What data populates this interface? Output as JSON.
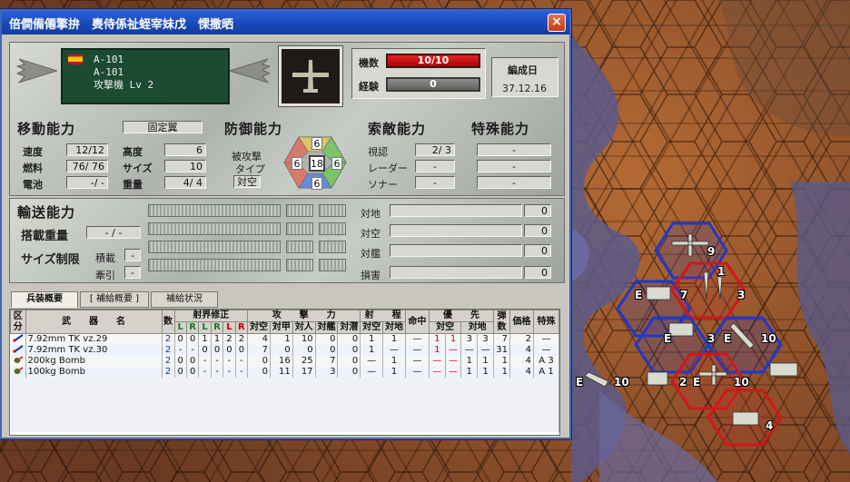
{
  "window": {
    "title": "倍僴備僊擎拚　軣侍係祉蛭宰妹戊　惈撒晒",
    "close_label": "×"
  },
  "unit": {
    "name_line1": "A-101",
    "name_line2": "A-101",
    "type_line": "攻撃機 Lv 2",
    "count_label": "機数",
    "count_value": "10/10",
    "exp_label": "経験",
    "exp_value": "0",
    "formed_label": "編成日",
    "formed_value": "37.12.16"
  },
  "movement": {
    "title": "移動能力",
    "type_value": "固定翼",
    "speed_label": "速度",
    "speed_value": "12/12",
    "fuel_label": "燃料",
    "fuel_value": "76/ 76",
    "battery_label": "電池",
    "battery_value": "-/ -",
    "altitude_label": "高度",
    "altitude_value": "6",
    "size_label": "サイズ",
    "size_value": "10",
    "weight_label": "重量",
    "weight_value": "4/ 4"
  },
  "defense": {
    "title": "防御能力",
    "attack_type_label1": "被攻撃",
    "attack_type_label2": "タイプ",
    "attack_type_value": "対空",
    "top": "6",
    "left": "6",
    "center": "18",
    "right": "6",
    "bottom": "6"
  },
  "search": {
    "title": "索敵能力",
    "visual_label": "視認",
    "visual_value": "2/ 3",
    "radar_label": "レーダー",
    "radar_value": "-",
    "sonar_label": "ソナー",
    "sonar_value": "-"
  },
  "special": {
    "title": "特殊能力",
    "slots": [
      "-",
      "-",
      "-",
      "-"
    ]
  },
  "transport": {
    "title": "輸送能力",
    "load_label": "搭載重量",
    "load_value": "- / -",
    "size_limit_label": "サイズ制限",
    "carry_label": "積載",
    "carry_value": "-",
    "tow_label": "牽引",
    "tow_value": "-"
  },
  "targets": [
    {
      "label": "対地",
      "value": "0"
    },
    {
      "label": "対空",
      "value": "0"
    },
    {
      "label": "対艦",
      "value": "0"
    },
    {
      "label": "損害",
      "value": "0"
    }
  ],
  "tabs": [
    "兵装概要",
    "[ 補給概要 ]",
    "補給状況"
  ],
  "weapons_table": {
    "h_kubun": "区分",
    "h_weapon": "武　　器　　名",
    "h_count": "数",
    "h_sight": "射界修正",
    "h_lr": [
      "L",
      "R",
      "L",
      "R",
      "L",
      "R"
    ],
    "h_attack": "攻　　撃　　力",
    "h_attack_sub": [
      "対空",
      "対甲",
      "対人",
      "対艦",
      "対潜"
    ],
    "h_range": "射　　程",
    "h_range_sub": [
      "対空",
      "対地"
    ],
    "h_hit": "命中",
    "h_priority": "優　　先",
    "h_priority_sub": [
      "対空",
      "対地"
    ],
    "h_ammo": "弾数",
    "h_price": "価格",
    "h_special": "特殊",
    "rows": [
      {
        "name": "7.92mm TK vz.29",
        "count": "2",
        "sight": [
          "0",
          "0",
          "1",
          "1",
          "2",
          "2"
        ],
        "atk": [
          "4",
          "1",
          "10",
          "0",
          "0"
        ],
        "rng_air": "1",
        "rng_gnd": "1",
        "hit": "—",
        "pri_air1": "1",
        "pri_air2": "1",
        "pri_gnd1": "3",
        "pri_gnd2": "3",
        "ammo": "7",
        "price": "2",
        "special": "—"
      },
      {
        "name": "7.92mm TK vz.30",
        "count": "2",
        "sight": [
          "-",
          "-",
          "0",
          "0",
          "0",
          "0"
        ],
        "atk": [
          "7",
          "0",
          "0",
          "0",
          "0"
        ],
        "rng_air": "1",
        "rng_gnd": "—",
        "hit": "—",
        "pri_air1": "1",
        "pri_air2": "—",
        "pri_gnd1": "—",
        "pri_gnd2": "—",
        "ammo": "31",
        "price": "4",
        "special": "—"
      },
      {
        "name": "200kg Bomb",
        "count": "2",
        "sight": [
          "0",
          "0",
          "-",
          "-",
          "-",
          "-"
        ],
        "atk": [
          "0",
          "16",
          "25",
          "7",
          "0"
        ],
        "rng_air": "—",
        "rng_gnd": "1",
        "hit": "—",
        "pri_air1": "—",
        "pri_air2": "—",
        "pri_gnd1": "1",
        "pri_gnd2": "1",
        "ammo": "1",
        "price": "4",
        "special": "A 3"
      },
      {
        "name": "100kg Bomb",
        "count": "2",
        "sight": [
          "0",
          "0",
          "-",
          "-",
          "-",
          "-"
        ],
        "atk": [
          "0",
          "11",
          "17",
          "3",
          "0"
        ],
        "rng_air": "—",
        "rng_gnd": "1",
        "hit": "—",
        "pri_air1": "—",
        "pri_air2": "—",
        "pri_gnd1": "1",
        "pri_gnd2": "1",
        "ammo": "1",
        "price": "4",
        "special": "A 1"
      }
    ]
  },
  "map_units": [
    {
      "label": "9"
    },
    {
      "label": "E"
    },
    {
      "label": "7"
    },
    {
      "label": "1"
    },
    {
      "label": "3"
    },
    {
      "label": "E"
    },
    {
      "label": "3"
    },
    {
      "label": "E"
    },
    {
      "label": "10"
    },
    {
      "label": "E"
    },
    {
      "label": "10"
    },
    {
      "label": "2"
    },
    {
      "label": "E"
    },
    {
      "label": "10"
    },
    {
      "label": "4"
    }
  ],
  "colors": {
    "titlebar": "#1848b8",
    "blue_hex": "#2038c8",
    "red_hex": "#d01818",
    "green_box": "#1d4a32"
  }
}
